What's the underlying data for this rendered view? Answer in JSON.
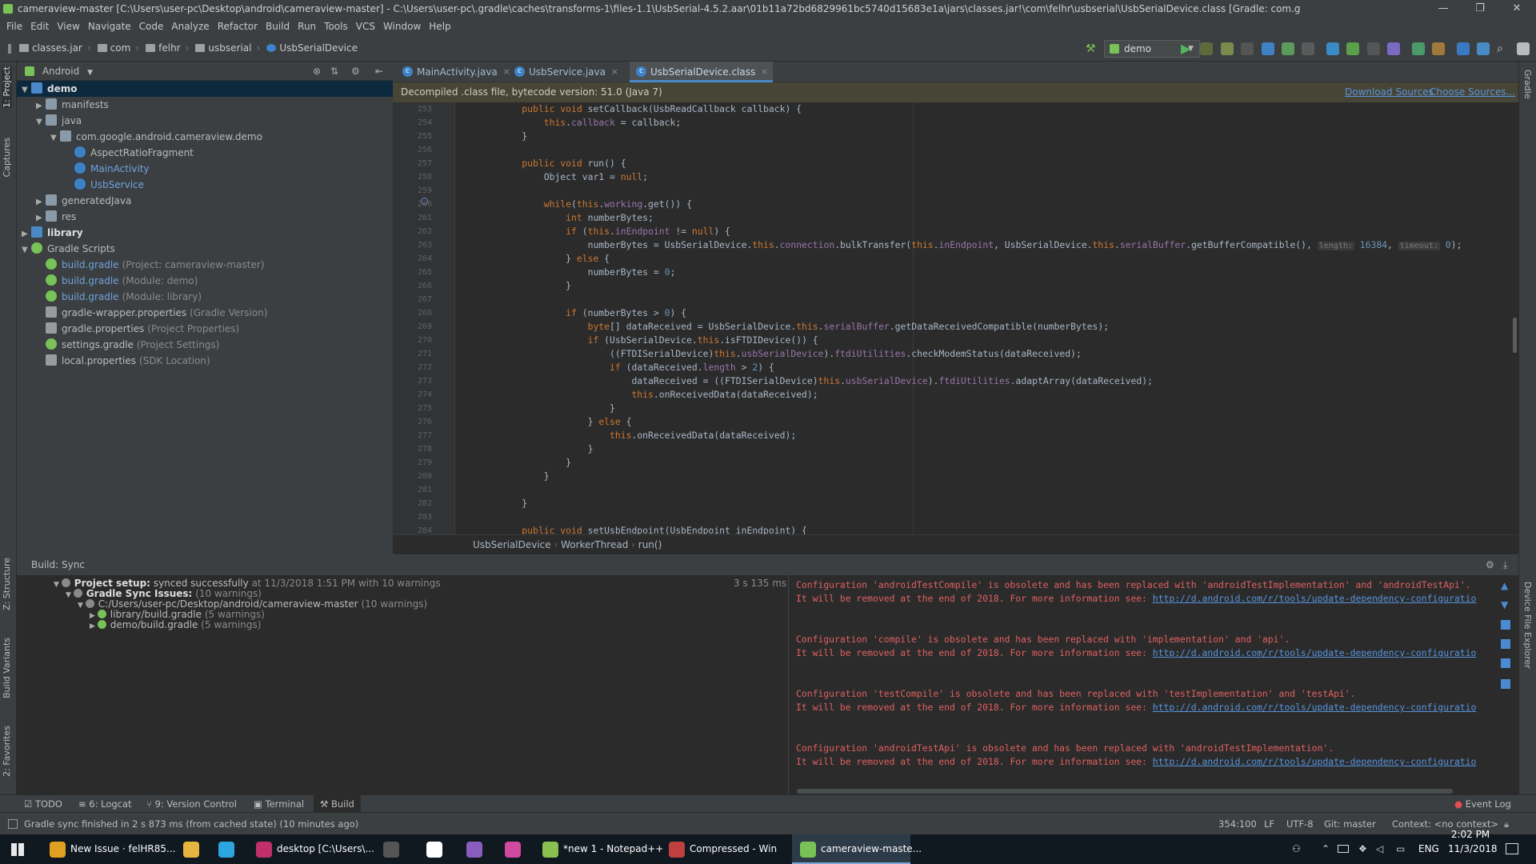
{
  "window": {
    "title": "cameraview-master [C:\\Users\\user-pc\\Desktop\\android\\cameraview-master] - C:\\Users\\user-pc\\.gradle\\caches\\transforms-1\\files-1.1\\UsbSerial-4.5.2.aar\\01b11a72bd6829961bc5740d15683e1a\\jars\\classes.jar!\\com\\felhr\\usbserial\\UsbSerialDevice.class [Gradle: com.g"
  },
  "menu": [
    "File",
    "Edit",
    "View",
    "Navigate",
    "Code",
    "Analyze",
    "Refactor",
    "Build",
    "Run",
    "Tools",
    "VCS",
    "Window",
    "Help"
  ],
  "breadcrumb": [
    "classes.jar",
    "com",
    "felhr",
    "usbserial",
    "UsbSerialDevice"
  ],
  "run_config": "demo",
  "left_tabs": [
    "1: Project",
    "Captures",
    "Z: Structure",
    "Build Variants",
    "2: Favorites"
  ],
  "right_tabs": [
    "Gradle",
    "Device File Explorer"
  ],
  "project": {
    "view": "Android",
    "tree": [
      {
        "label": "demo",
        "extra": "",
        "depth": 0,
        "arrow": "▼",
        "icon": "module",
        "bold": true,
        "selected": true
      },
      {
        "label": "manifests",
        "extra": "",
        "depth": 1,
        "arrow": "▶",
        "icon": "folder"
      },
      {
        "label": "java",
        "extra": "",
        "depth": 1,
        "arrow": "▼",
        "icon": "folder"
      },
      {
        "label": "com.google.android.cameraview.demo",
        "extra": "",
        "depth": 2,
        "arrow": "▼",
        "icon": "package"
      },
      {
        "label": "AspectRatioFragment",
        "extra": "",
        "depth": 3,
        "arrow": "",
        "icon": "class"
      },
      {
        "label": "MainActivity",
        "extra": "",
        "depth": 3,
        "arrow": "",
        "icon": "class",
        "blue": true
      },
      {
        "label": "UsbService",
        "extra": "",
        "depth": 3,
        "arrow": "",
        "icon": "class",
        "blue": true
      },
      {
        "label": "generatedJava",
        "extra": "",
        "depth": 1,
        "arrow": "▶",
        "icon": "folder"
      },
      {
        "label": "res",
        "extra": "",
        "depth": 1,
        "arrow": "▶",
        "icon": "folder"
      },
      {
        "label": "library",
        "extra": "",
        "depth": 0,
        "arrow": "▶",
        "icon": "module",
        "bold": true
      },
      {
        "label": "Gradle Scripts",
        "extra": "",
        "depth": 0,
        "arrow": "▼",
        "icon": "gradle"
      },
      {
        "label": "build.gradle",
        "extra": "(Project: cameraview-master)",
        "depth": 1,
        "arrow": "",
        "icon": "gradle",
        "blue": true
      },
      {
        "label": "build.gradle",
        "extra": "(Module: demo)",
        "depth": 1,
        "arrow": "",
        "icon": "gradle",
        "blue": true
      },
      {
        "label": "build.gradle",
        "extra": "(Module: library)",
        "depth": 1,
        "arrow": "",
        "icon": "gradle",
        "blue": true
      },
      {
        "label": "gradle-wrapper.properties",
        "extra": "(Gradle Version)",
        "depth": 1,
        "arrow": "",
        "icon": "props"
      },
      {
        "label": "gradle.properties",
        "extra": "(Project Properties)",
        "depth": 1,
        "arrow": "",
        "icon": "props"
      },
      {
        "label": "settings.gradle",
        "extra": "(Project Settings)",
        "depth": 1,
        "arrow": "",
        "icon": "gradle"
      },
      {
        "label": "local.properties",
        "extra": "(SDK Location)",
        "depth": 1,
        "arrow": "",
        "icon": "props"
      }
    ]
  },
  "editor": {
    "tabs": [
      {
        "label": "MainActivity.java",
        "active": false
      },
      {
        "label": "UsbService.java",
        "active": false
      },
      {
        "label": "UsbSerialDevice.class",
        "active": true
      }
    ],
    "banner": "Decompiled .class file, bytecode version: 51.0 (Java 7)",
    "download_sources": "Download Sources",
    "choose_sources": "Choose Sources...",
    "first_line": 253,
    "lines": [
      "            <k>public void</k> setCallback(UsbReadCallback callback) {",
      "                <k>this</k>.<f>callback</f> = callback;",
      "            }",
      "",
      "            <k>public void</k> run() {",
      "                Object var1 = <k>null</k>;",
      "",
      "                <k>while</k>(<k>this</k>.<f>working</f>.get()) {",
      "                    <k>int</k> numberBytes;",
      "                    <k>if</k> (<k>this</k>.<f>inEndpoint</f> != <k>null</k>) {",
      "                        numberBytes = UsbSerialDevice.<k>this</k>.<f>connection</f>.bulkTransfer(<k>this</k>.<f>inEndpoint</f>, UsbSerialDevice.<k>this</k>.<f>serialBuffer</f>.getBufferCompatible(), <h>length:</h> <n>16384</n>, <h>timeout:</h> <n>0</n>);",
      "                    } <k>else</k> {",
      "                        numberBytes = <n>0</n>;",
      "                    }",
      "",
      "                    <k>if</k> (numberBytes > <n>0</n>) {",
      "                        <k>byte</k>[] dataReceived = UsbSerialDevice.<k>this</k>.<f>serialBuffer</f>.getDataReceivedCompatible(numberBytes);",
      "                        <k>if</k> (UsbSerialDevice.<k>this</k>.isFTDIDevice()) {",
      "                            ((FTDISerialDevice)<k>this</k>.<f>usbSerialDevice</f>).<f>ftdiUtilities</f>.checkModemStatus(dataReceived);",
      "                            <k>if</k> (dataReceived.<f>length</f> > <n>2</n>) {",
      "                                dataReceived = ((FTDISerialDevice)<k>this</k>.<f>usbSerialDevice</f>).<f>ftdiUtilities</f>.adaptArray(dataReceived);",
      "                                <k>this</k>.onReceivedData(dataReceived);",
      "                            }",
      "                        } <k>else</k> {",
      "                            <k>this</k>.onReceivedData(dataReceived);",
      "                        }",
      "                    }",
      "                }",
      "",
      "            }",
      "",
      "            <k>public void</k> setUsbEndpoint(UsbEndpoint inEndpoint) {"
    ],
    "breadcrumb": [
      "UsbSerialDevice",
      "WorkerThread",
      "run()"
    ]
  },
  "build": {
    "title": "Build: Sync",
    "tree": [
      {
        "depth": 0,
        "arrow": "▼",
        "bold": "Project setup:",
        "text": "synced successfully",
        "extra": "at 11/3/2018 1:51 PM   with 10 warnings",
        "time": "3 s 135 ms"
      },
      {
        "depth": 1,
        "arrow": "▼",
        "bold": "Gradle Sync Issues:",
        "text": "",
        "extra": "(10 warnings)"
      },
      {
        "depth": 2,
        "arrow": "▼",
        "bold": "",
        "text": "C:/Users/user-pc/Desktop/android/cameraview-master",
        "extra": "(10 warnings)"
      },
      {
        "depth": 3,
        "arrow": "▶",
        "bold": "",
        "text": "library/build.gradle",
        "extra": "(5 warnings)"
      },
      {
        "depth": 3,
        "arrow": "▶",
        "bold": "",
        "text": "demo/build.gradle",
        "extra": "(5 warnings)"
      }
    ],
    "console": [
      {
        "line1": "Configuration 'androidTestCompile' is obsolete and has been replaced with 'androidTestImplementation' and 'androidTestApi'.",
        "line2": "It will be removed at the end of 2018. For more information see: ",
        "link": "http://d.android.com/r/tools/update-dependency-configuratio"
      },
      {
        "line1": "Configuration 'compile' is obsolete and has been replaced with 'implementation' and 'api'.",
        "line2": "It will be removed at the end of 2018. For more information see: ",
        "link": "http://d.android.com/r/tools/update-dependency-configuratio"
      },
      {
        "line1": "Configuration 'testCompile' is obsolete and has been replaced with 'testImplementation' and 'testApi'.",
        "line2": "It will be removed at the end of 2018. For more information see: ",
        "link": "http://d.android.com/r/tools/update-dependency-configuratio"
      },
      {
        "line1": "Configuration 'androidTestApi' is obsolete and has been replaced with 'androidTestImplementation'.",
        "line2": "It will be removed at the end of 2018. For more information see: ",
        "link": "http://d.android.com/r/tools/update-dependency-configuratio"
      }
    ]
  },
  "toolwindows": [
    "TODO",
    "6: Logcat",
    "9: Version Control",
    "Terminal",
    "Build"
  ],
  "event_log": "Event Log",
  "status": {
    "message": "Gradle sync finished in 2 s 873 ms (from cached state) (10 minutes ago)",
    "position": "354:100",
    "line_sep": "LF",
    "encoding": "UTF-8",
    "git": "Git: master",
    "context": "Context: <no context>"
  },
  "taskbar": {
    "items": [
      {
        "label": "New Issue · felHR85...",
        "color": "#e0a020"
      },
      {
        "label": "",
        "color": "#e8b440"
      },
      {
        "label": "",
        "color": "#2ca5e0"
      },
      {
        "label": "desktop [C:\\Users\\...",
        "color": "#c0306a"
      },
      {
        "label": "",
        "color": "#555555"
      },
      {
        "label": "",
        "color": "#ffffff"
      },
      {
        "label": "",
        "color": "#8a5cc0"
      },
      {
        "label": "",
        "color": "#d04aa0"
      },
      {
        "label": "*new 1 - Notepad++",
        "color": "#8ac050"
      },
      {
        "label": "Compressed - Win",
        "color": "#c04040"
      },
      {
        "label": "cameraview-maste...",
        "color": "#78c257",
        "active": true
      }
    ],
    "lang": "ENG",
    "time": "2:02 PM",
    "date": "11/3/2018"
  }
}
